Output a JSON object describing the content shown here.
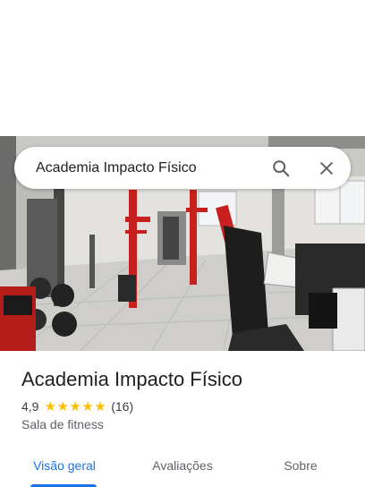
{
  "search": {
    "query": "Academia Impacto Físico"
  },
  "icons": {
    "search": "search-icon",
    "close": "close-icon",
    "star": "star-icon"
  },
  "place": {
    "name": "Academia Impacto Físico",
    "rating": "4,9",
    "stars": 5,
    "reviews": "(16)",
    "category": "Sala de fitness"
  },
  "tabs": [
    {
      "label": "Visão geral",
      "active": true
    },
    {
      "label": "Avaliações",
      "active": false
    },
    {
      "label": "Sobre",
      "active": false
    }
  ],
  "colors": {
    "accent": "#1a73e8",
    "star": "#fbbc04",
    "text": "#202124",
    "secondary": "#5f6368",
    "equipment_red": "#c8201e"
  }
}
